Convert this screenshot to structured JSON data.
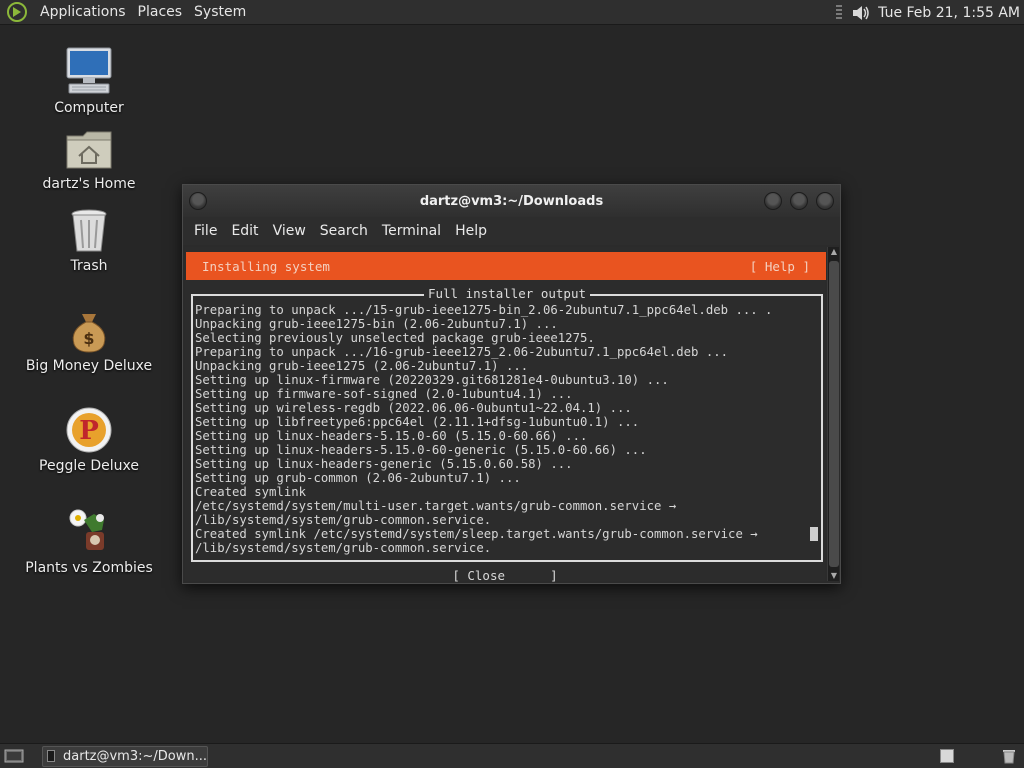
{
  "top_panel": {
    "menus": [
      "Applications",
      "Places",
      "System"
    ],
    "clock": "Tue Feb 21,  1:55 AM"
  },
  "desktop": {
    "icons": [
      {
        "label": "Computer",
        "icon": "computer-icon"
      },
      {
        "label": "dartz's Home",
        "icon": "home-folder-icon"
      },
      {
        "label": "Trash",
        "icon": "trash-icon"
      },
      {
        "label": "Big Money Deluxe",
        "icon": "money-bag-icon"
      },
      {
        "label": "Peggle Deluxe",
        "icon": "peggle-icon"
      },
      {
        "label": "Plants vs Zombies",
        "icon": "plants-vs-zombies-icon"
      }
    ]
  },
  "window": {
    "title": "dartz@vm3:~/Downloads",
    "menu": [
      "File",
      "Edit",
      "View",
      "Search",
      "Terminal",
      "Help"
    ]
  },
  "installer": {
    "header": "Installing system",
    "help": "[ Help ]",
    "output_title": "Full installer output",
    "lines": [
      "Preparing to unpack .../15-grub-ieee1275-bin_2.06-2ubuntu7.1_ppc64el.deb ... .",
      "Unpacking grub-ieee1275-bin (2.06-2ubuntu7.1) ...",
      "Selecting previously unselected package grub-ieee1275.",
      "Preparing to unpack .../16-grub-ieee1275_2.06-2ubuntu7.1_ppc64el.deb ...",
      "Unpacking grub-ieee1275 (2.06-2ubuntu7.1) ...",
      "Setting up linux-firmware (20220329.git681281e4-0ubuntu3.10) ...",
      "Setting up firmware-sof-signed (2.0-1ubuntu4.1) ...",
      "Setting up wireless-regdb (2022.06.06-0ubuntu1~22.04.1) ...",
      "Setting up libfreetype6:ppc64el (2.11.1+dfsg-1ubuntu0.1) ...",
      "Setting up linux-headers-5.15.0-60 (5.15.0-60.66) ...",
      "Setting up linux-headers-5.15.0-60-generic (5.15.0-60.66) ...",
      "Setting up linux-headers-generic (5.15.0.60.58) ...",
      "Setting up grub-common (2.06-2ubuntu7.1) ...",
      "Created symlink",
      "/etc/systemd/system/multi-user.target.wants/grub-common.service →",
      "/lib/systemd/system/grub-common.service.",
      "Created symlink /etc/systemd/system/sleep.target.wants/grub-common.service →",
      "/lib/systemd/system/grub-common.service."
    ],
    "close": "[ Close      ]"
  },
  "bottom_panel": {
    "task": "dartz@vm3:~/Down..."
  },
  "colors": {
    "accent": "#e95420",
    "desktop_bg": "#262626",
    "panel_bg": "#2f2f2f"
  }
}
